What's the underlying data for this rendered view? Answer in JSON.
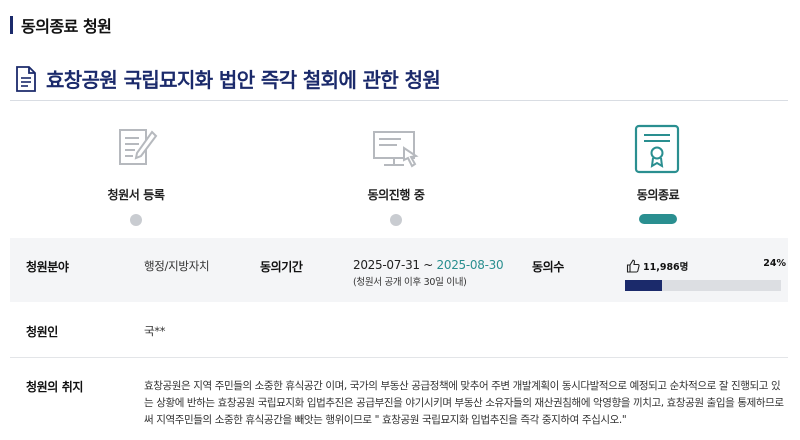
{
  "section": {
    "title": "동의종료 청원"
  },
  "petition": {
    "title": "효창공원 국립묘지화 법안 즉각 철회에 관한 청원"
  },
  "steps": [
    {
      "label": "청원서 등록",
      "icon": "document-pen-icon",
      "state": "done"
    },
    {
      "label": "동의진행 중",
      "icon": "computer-touch-icon",
      "state": "done"
    },
    {
      "label": "동의종료",
      "icon": "certificate-icon",
      "state": "current"
    }
  ],
  "details": {
    "category_label": "청원분야",
    "category_value": "행정/지방자치",
    "period_label": "동의기간",
    "period_start": "2025-07-31",
    "period_sep": " ~ ",
    "period_end": "2025-08-30",
    "period_note": "(청원서 공개 이후 30일 이내)",
    "agree_label": "동의수",
    "agree_count": "11,986명",
    "agree_percent": "24%",
    "agree_progress": 0.24,
    "petitioner_label": "청원인",
    "petitioner_value": "국**",
    "purpose_label": "청원의 취지",
    "purpose_text": "효창공원은 지역 주민들의 소중한 휴식공간 이며,  국가의 부동산 공급정책에 맞추어 주변 개발계획이 동시다발적으로 예정되고 순차적으로 잘 진행되고 있는 상황에 반하는 효창공원 국립묘지화 입법추진은  공급부진을 야기시키며  부동산 소유자들의 재산권침해에 악영향을 끼치고, 효창공원  출입을 통제하므로써 지역주민들의 소중한 휴식공간을 빼앗는 행위이므로 \" 효창공원 국립묘지화 입법추진을 즉각 중지하여 주십시오.\""
  },
  "colors": {
    "navy": "#1b2a6b",
    "teal": "#2a8f90",
    "gray_dot": "#c9ccd1"
  }
}
